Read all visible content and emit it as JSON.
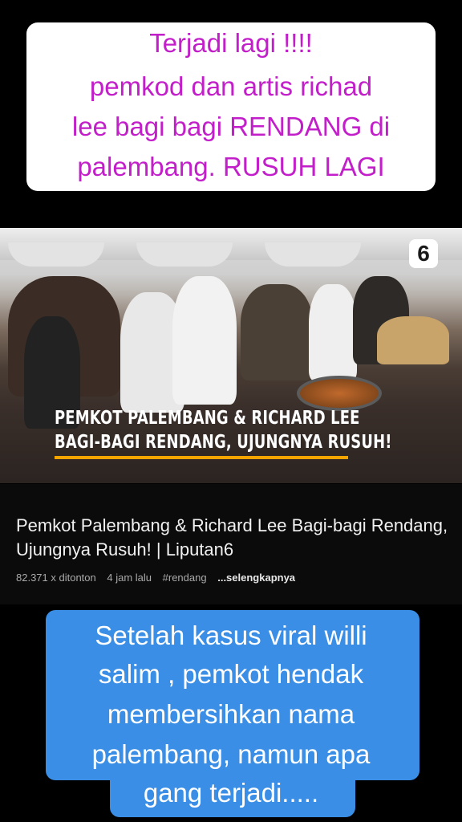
{
  "caption_top": {
    "lines": [
      "Terjadi lagi !!!!",
      "pemkod dan artis richad",
      "lee bagi bagi RENDANG di",
      "palembang. RUSUH LAGI"
    ],
    "text_color": "#c21ec9"
  },
  "video": {
    "channel_logo": "6",
    "banner_lines": [
      "PEMKOT PALEMBANG & RICHARD LEE",
      "BAGI-BAGI RENDANG, UJUNGNYA RUSUH!"
    ],
    "accent": "#f5a400"
  },
  "video_info": {
    "title": "Pemkot Palembang & Richard Lee Bagi-bagi Rendang, Ujungnya Rusuh! | Liputan6",
    "views": "82.371 x ditonton",
    "age": "4 jam lalu",
    "hashtag": "#rendang",
    "more": "...selengkapnya"
  },
  "caption_bottom": {
    "lines": [
      "Setelah kasus viral willi",
      "salim , pemkot hendak",
      "membersihkan nama",
      "palembang, namun apa",
      "gang terjadi....."
    ],
    "bg_color": "#3a8ee6"
  }
}
